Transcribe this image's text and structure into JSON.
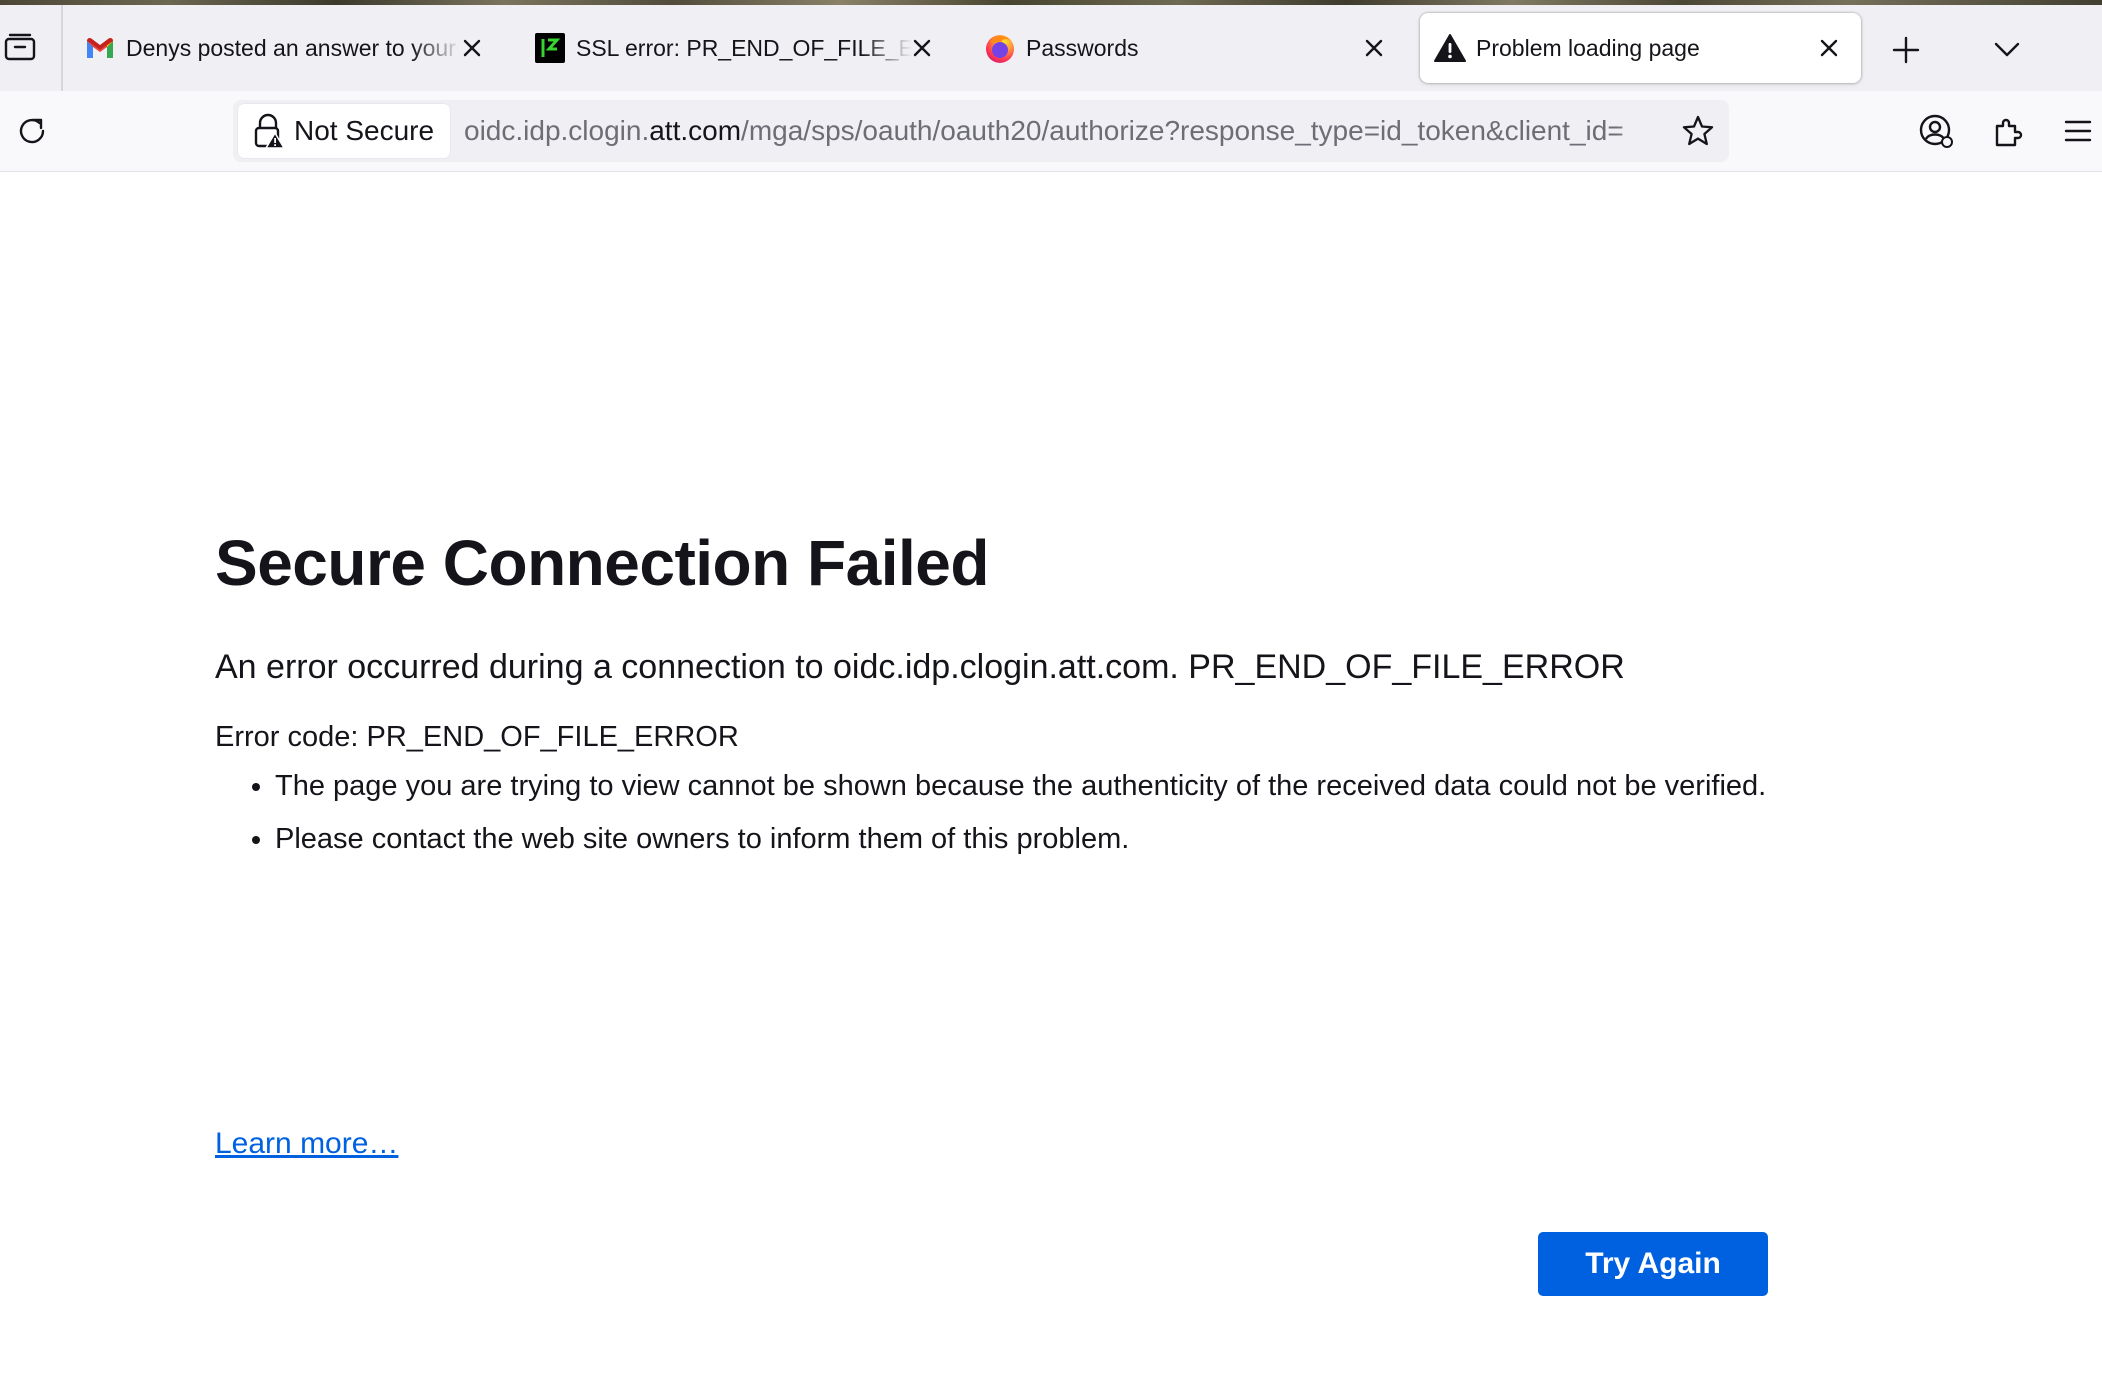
{
  "browser": {
    "tabs": [
      {
        "title": "Denys posted an answer to your",
        "favicon": "gmail-icon",
        "active": false
      },
      {
        "title": "SSL error: PR_END_OF_FILE_ERROR",
        "favicon": "stackexchange-icon",
        "active": false
      },
      {
        "title": "Passwords",
        "favicon": "firefox-icon",
        "active": false
      },
      {
        "title": "Problem loading page",
        "favicon": "warning-icon",
        "active": true
      }
    ],
    "identity_label": "Not Secure",
    "url": {
      "prefix": "oidc.idp.clogin.",
      "host": "att.com",
      "path": "/mga/sps/oauth/oauth20/authorize?response_type=id_token&client_id="
    },
    "colors": {
      "accent": "#0061e0",
      "text": "#15141a",
      "toolbar": "#f9f9fb",
      "tabstrip": "#f0f0f4"
    }
  },
  "error": {
    "title": "Secure Connection Failed",
    "short_desc": "An error occurred during a connection to oidc.idp.clogin.att.com. PR_END_OF_FILE_ERROR",
    "error_code": "Error code: PR_END_OF_FILE_ERROR",
    "details": [
      "The page you are trying to view cannot be shown because the authenticity of the received data could not be verified.",
      "Please contact the web site owners to inform them of this problem."
    ],
    "learn_more": "Learn more…",
    "try_again": "Try Again"
  }
}
